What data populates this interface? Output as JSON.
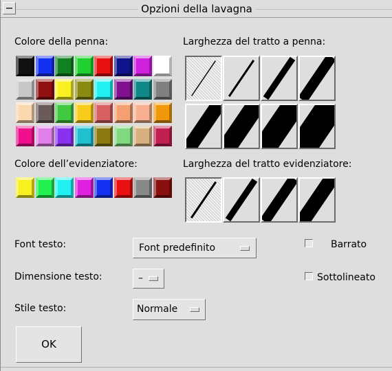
{
  "window": {
    "title": "Opzioni della lavagna"
  },
  "pen_color": {
    "label": "Colore della penna:",
    "swatches": [
      "#111111",
      "#1230f0",
      "#108020",
      "#20d030",
      "#e81010",
      "#10148c",
      "#d020e0",
      "#ffffff",
      "#c8c8c8",
      "#901010",
      "#f8f020",
      "#8a8a10",
      "#20f0f0",
      "#801090",
      "#108888",
      "#808080",
      "#fbd8b0",
      "#6a5a58",
      "#40c840",
      "#f8cc18",
      "#d86060",
      "#f4a070",
      "#f8b090",
      "#f0980a",
      "#f0108c",
      "#e080e8",
      "#8a30f0",
      "#20c0d0",
      "#8a7a10",
      "#80d880",
      "#d8b080",
      "#c02050"
    ]
  },
  "highlighter_color": {
    "label": "Colore dell’evidenziatore:",
    "swatches": [
      "#f8f020",
      "#20f050",
      "#20f0f0",
      "#e020e0",
      "#1430f0",
      "#e81010",
      "#888888",
      "#8a1010"
    ]
  },
  "pen_width": {
    "label": "Larghezza del tratto a penna:",
    "widths": [
      1,
      3,
      9,
      15,
      21,
      27,
      33,
      40
    ],
    "selected_index": 0
  },
  "highlighter_width": {
    "label": "Larghezza del tratto evidenziatore:",
    "widths": [
      3,
      9,
      15,
      21
    ],
    "selected_index": 0
  },
  "font": {
    "label": "Font testo:",
    "value": "Font predefinito"
  },
  "size": {
    "label": "Dimensione testo:",
    "value": "–"
  },
  "style": {
    "label": "Stile testo:",
    "value": "Normale"
  },
  "strike": {
    "label": "Barrato",
    "checked": false
  },
  "underline": {
    "label": "Sottolineato",
    "checked": false
  },
  "ok": {
    "label": "OK"
  }
}
